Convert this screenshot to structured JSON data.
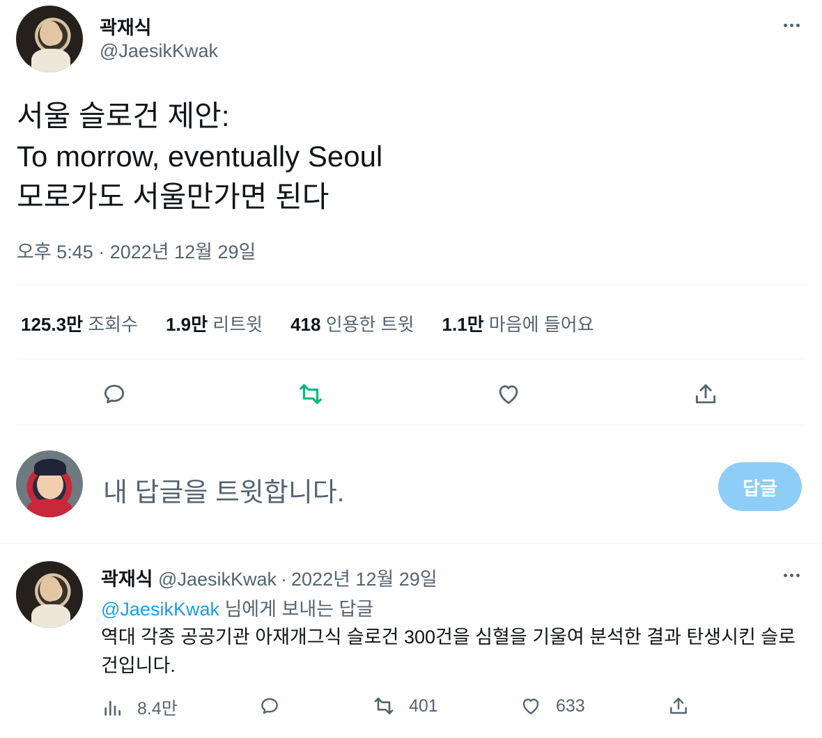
{
  "tweet": {
    "author_name": "곽재식",
    "author_handle": "@JaesikKwak",
    "text_lines": [
      "서울 슬로건 제안:",
      "To morrow, eventually Seoul",
      "모로가도 서울만가면 된다"
    ],
    "timestamp": "오후 5:45 · 2022년 12월 29일",
    "stats": {
      "views_count": "125.3만",
      "views_label": "조회수",
      "retweets_count": "1.9만",
      "retweets_label": "리트윗",
      "quotes_count": "418",
      "quotes_label": "인용한 트윗",
      "likes_count": "1.1만",
      "likes_label": "마음에 들어요"
    }
  },
  "reply_composer": {
    "placeholder": "내 답글을 트윗합니다.",
    "button_label": "답글"
  },
  "reply": {
    "author_name": "곽재식",
    "author_handle": "@JaesikKwak",
    "date": "2022년 12월 29일",
    "mention": "@JaesikKwak",
    "reply_to_suffix": " 님에게 보내는 답글",
    "body": "역대 각종 공공기관 아재개그식 슬로건 300건을 심혈을 기울여 분석한 결과 탄생시킨 슬로건입니다.",
    "views": "8.4만",
    "retweets": "401",
    "likes": "633"
  },
  "colors": {
    "accent_blue": "#1d9bf0",
    "retweet_green": "#00ba7c",
    "secondary_text": "#536471",
    "reply_button_disabled": "#8ecdf8"
  },
  "icons": [
    "more-icon",
    "reply-icon",
    "retweet-icon",
    "like-icon",
    "share-icon",
    "views-icon"
  ]
}
